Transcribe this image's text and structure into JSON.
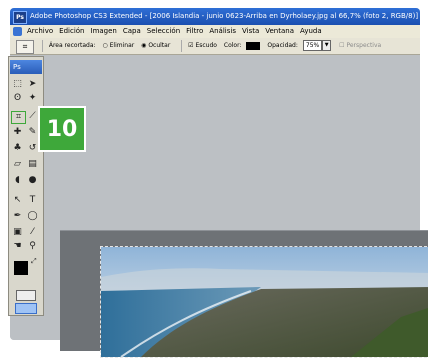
{
  "window": {
    "title": "Adobe Photoshop CS3 Extended - [2006 Islandia - junio 0623-Arriba en Dyrholaey.jpg al 66,7% (foto 2, RGB/8)]",
    "app_badge": "Ps"
  },
  "menubar": {
    "items": [
      "Archivo",
      "Edición",
      "Imagen",
      "Capa",
      "Selección",
      "Filtro",
      "Análisis",
      "Vista",
      "Ventana",
      "Ayuda"
    ]
  },
  "options_bar": {
    "area_label": "Área recortada:",
    "delete_label": "Eliminar",
    "hide_label": "Ocultar",
    "shield_label": "Escudo",
    "color_label": "Color:",
    "opacity_label": "Opacidad:",
    "opacity_value": "75%",
    "perspective_label": "Perspectiva",
    "shield_color": "#000000"
  },
  "toolbox": {
    "logo": "Ps",
    "foreground_color": "#000000",
    "background_color": "#ffffff"
  },
  "callout": {
    "step_number": "10",
    "color": "#3ea83a"
  }
}
